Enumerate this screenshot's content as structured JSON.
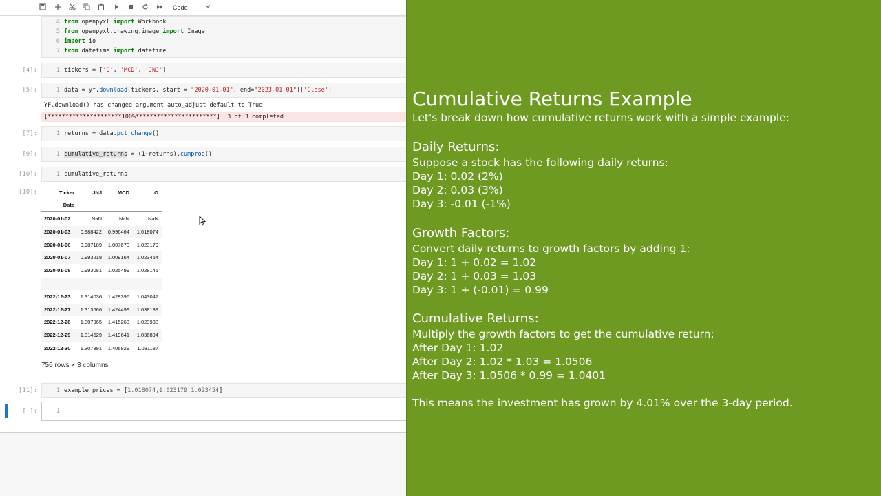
{
  "toolbar": {
    "cell_type": "Code",
    "icons": [
      "save-icon",
      "add-icon",
      "cut-icon",
      "copy-icon",
      "paste-icon",
      "run-icon",
      "stop-icon",
      "restart-icon",
      "fast-forward-icon",
      "chevron-down-icon"
    ]
  },
  "cell1": {
    "line_numbers": [
      "4",
      "5",
      "6",
      "7"
    ],
    "lines": [
      {
        "kw1": "from",
        "mod": " openpyxl ",
        "kw2": "import",
        "rest": " Workbook"
      },
      {
        "kw1": "from",
        "mod": " openpyxl.drawing.image ",
        "kw2": "import",
        "rest": " Image"
      },
      {
        "kw1": "import",
        "mod": " io",
        "kw2": "",
        "rest": ""
      },
      {
        "kw1": "from",
        "mod": " datetime ",
        "kw2": "import",
        "rest": " datetime"
      }
    ]
  },
  "cell4": {
    "prompt": "[4]:",
    "ln": "1",
    "a": "tickers = [",
    "s1": "'O'",
    ",b": ", ",
    "s2": "'MCD'",
    "c": ", ",
    "s3": "'JNJ'",
    "d": "]"
  },
  "cell5": {
    "prompt": "[5]:",
    "ln": "1",
    "a": "data = yf.",
    "fn": "download",
    "b": "(tickers, start = ",
    "s1": "\"2020-01-01\"",
    "c": ", end=",
    "s2": "\"2023-01-01\"",
    "d": ")[",
    "s3": "'Close'",
    "e": "]"
  },
  "out5": {
    "line1": "YF.download() has changed argument auto_adjust default to True",
    "line2": "[*********************100%***********************]  3 of 3 completed"
  },
  "cell7": {
    "prompt": "[7]:",
    "ln": "1",
    "a": "returns = data.",
    "fn": "pct_change",
    "b": "()"
  },
  "cell9": {
    "prompt": "[9]:",
    "ln": "1",
    "hl": "cumulative_returns",
    "a": " = (1+returns).",
    "fn": "cumprod",
    "b": "()"
  },
  "cell10": {
    "prompt": "[10]:",
    "ln": "1",
    "a": "cumulative_returns",
    "out_prompt": "[10]:"
  },
  "dataframe": {
    "columns": [
      "Ticker",
      "JNJ",
      "MCD",
      "O"
    ],
    "index_name": "Date",
    "rows": [
      [
        "2020-01-02",
        "NaN",
        "NaN",
        "NaN"
      ],
      [
        "2020-01-03",
        "0.988422",
        "0.996464",
        "1.018074"
      ],
      [
        "2020-01-06",
        "0.987189",
        "1.007670",
        "1.023179"
      ],
      [
        "2020-01-07",
        "0.993218",
        "1.009164",
        "1.023454"
      ],
      [
        "2020-01-08",
        "0.993081",
        "1.025499",
        "1.028145"
      ],
      [
        "...",
        "...",
        "...",
        "..."
      ],
      [
        "2022-12-23",
        "1.314036",
        "1.428396",
        "1.043047"
      ],
      [
        "2022-12-27",
        "1.313666",
        "1.424499",
        "1.038189"
      ],
      [
        "2022-12-28",
        "1.307965",
        "1.415263",
        "1.023938"
      ],
      [
        "2022-12-29",
        "1.314629",
        "1.419641",
        "1.036894"
      ],
      [
        "2022-12-30",
        "1.307891",
        "1.406829",
        "1.031187"
      ]
    ],
    "shape": "756 rows × 3 columns"
  },
  "cell11": {
    "prompt": "[11]:",
    "ln": "1",
    "a": "example_prices = [",
    "nums": "1.018074,1.023179,1.023454",
    "b": "]"
  },
  "cell_empty": {
    "prompt": "[ ]:",
    "ln": "1"
  },
  "slide": {
    "title": "Cumulative Returns Example",
    "intro": "Let's break down how cumulative returns work with a simple example:",
    "sections": [
      {
        "heading": "Daily Returns:",
        "lines": [
          "Suppose a stock has the following daily returns:",
          "Day 1: 0.02 (2%)",
          "Day 2: 0.03 (3%)",
          "Day 3: -0.01 (-1%)"
        ]
      },
      {
        "heading": "Growth Factors:",
        "lines": [
          "Convert daily returns to growth factors by adding 1:",
          "Day 1: 1 + 0.02 = 1.02",
          "Day 2: 1 + 0.03 = 1.03",
          "Day 3: 1 + (-0.01) = 0.99"
        ]
      },
      {
        "heading": "Cumulative Returns:",
        "lines": [
          "Multiply the growth factors to get the cumulative return:",
          "After Day 1: 1.02",
          "After Day 2: 1.02 * 1.03 = 1.0506",
          "After Day 3: 1.0506 * 0.99 = 1.0401"
        ]
      }
    ],
    "conclusion": "This means the investment has grown by 4.01% over the 3-day period.",
    "colors": {
      "background": "#6f9a22",
      "text": "#ffffff"
    }
  }
}
